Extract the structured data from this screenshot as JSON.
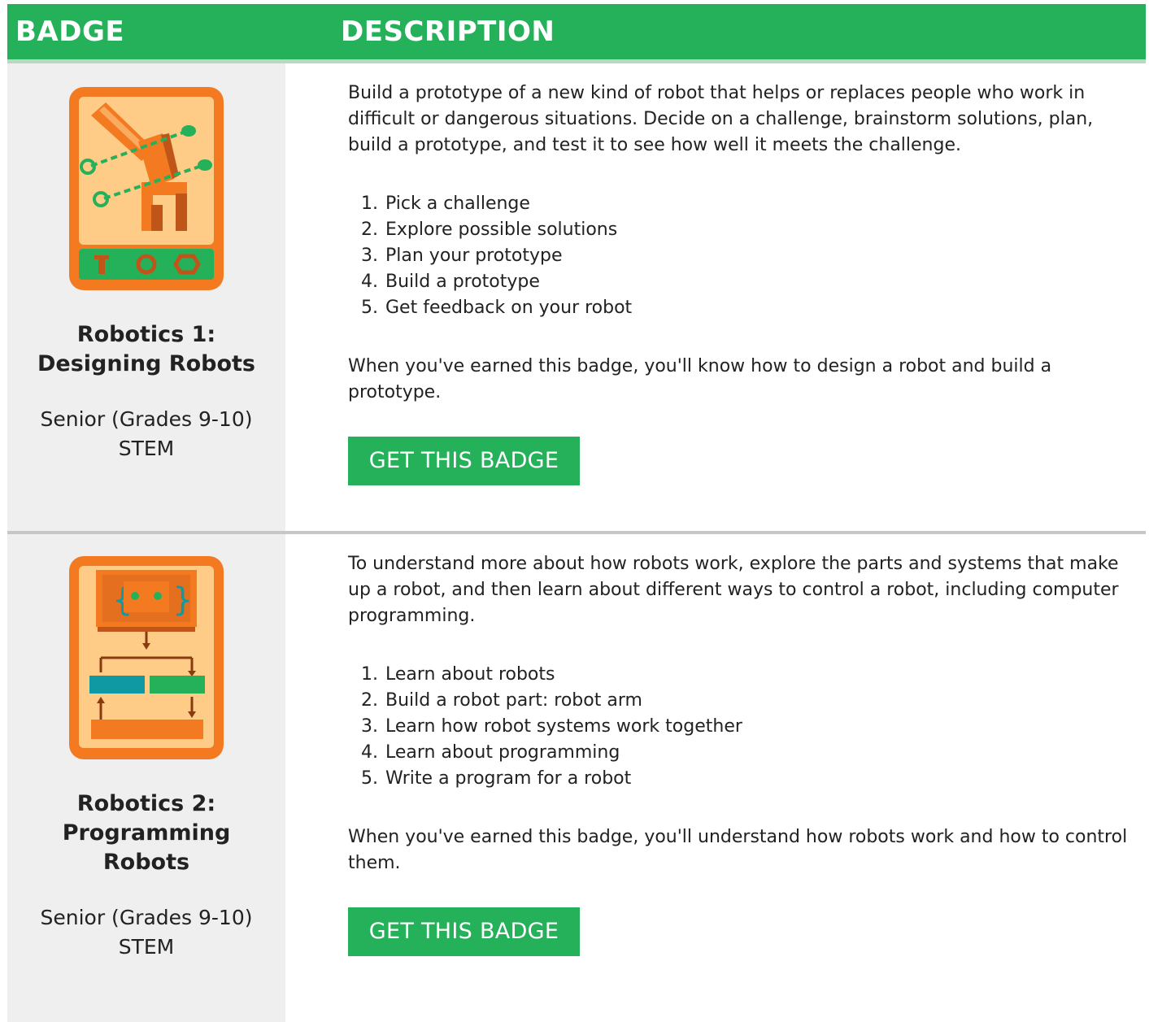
{
  "header": {
    "badge": "BADGE",
    "description": "DESCRIPTION"
  },
  "badges": [
    {
      "name": "Robotics 1: Designing Robots",
      "level": "Senior (Grades 9-10)",
      "category": "STEM",
      "description": "Build a prototype of a new kind of robot that helps or replaces people who work in difficult or dangerous situations. Decide on a challenge, brainstorm solutions, plan, build a prototype, and test it to see how well it meets the challenge.",
      "steps": [
        "Pick a challenge",
        "Explore possible solutions",
        "Plan your prototype",
        "Build a prototype",
        "Get feedback on your robot"
      ],
      "earned": "When you've earned this badge, you'll know how to design a robot and build a prototype.",
      "button": "GET THIS BADGE",
      "icon": "robot-arm-badge-icon"
    },
    {
      "name": "Robotics 2: Programming Robots",
      "level": "Senior (Grades 9-10)",
      "category": "STEM",
      "description": "To understand more about how robots work, explore the parts and systems that make up a robot, and then learn about different ways to control a robot, including computer programming.",
      "steps": [
        "Learn about robots",
        "Build a robot part: robot arm",
        "Learn how robot systems work together",
        "Learn about programming",
        "Write a program for a robot"
      ],
      "earned": "When you've earned this badge, you'll understand how robots work and how to control them.",
      "button": "GET THIS BADGE",
      "icon": "robot-program-badge-icon"
    }
  ],
  "colors": {
    "green": "#25b15a",
    "orange": "#f47a22",
    "cream": "#ffcc88",
    "teal": "#0f9aa3"
  }
}
